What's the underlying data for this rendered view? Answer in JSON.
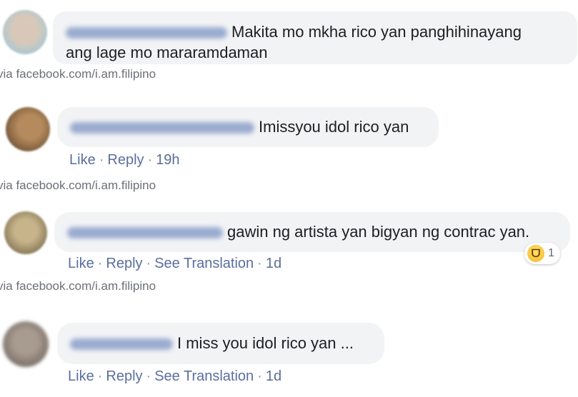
{
  "source_caption": "via facebook.com/i.am.filipino",
  "comments": [
    {
      "text_line1": "Makita mo mkha rico yan panghihinayang",
      "text_line2": "ang lage mo mararamdaman",
      "avatar_color": "#c9b8a8"
    },
    {
      "text": "Imissyou idol rico yan",
      "actions": {
        "like": "Like",
        "reply": "Reply",
        "time": "19h"
      },
      "avatar_color": "#8a6a4a"
    },
    {
      "text": "gawin ng artista yan bigyan ng contrac yan.",
      "actions": {
        "like": "Like",
        "reply": "Reply",
        "translate": "See Translation",
        "time": "1d"
      },
      "reaction": {
        "icon": "haha-emoji-icon",
        "count": "1"
      },
      "avatar_color": "#9a8a6a"
    },
    {
      "text": "I miss you idol rico yan ...",
      "actions": {
        "like": "Like",
        "reply": "Reply",
        "translate": "See Translation",
        "time": "1d"
      },
      "avatar_color": "#7d7268"
    }
  ],
  "separator_dot": "·"
}
